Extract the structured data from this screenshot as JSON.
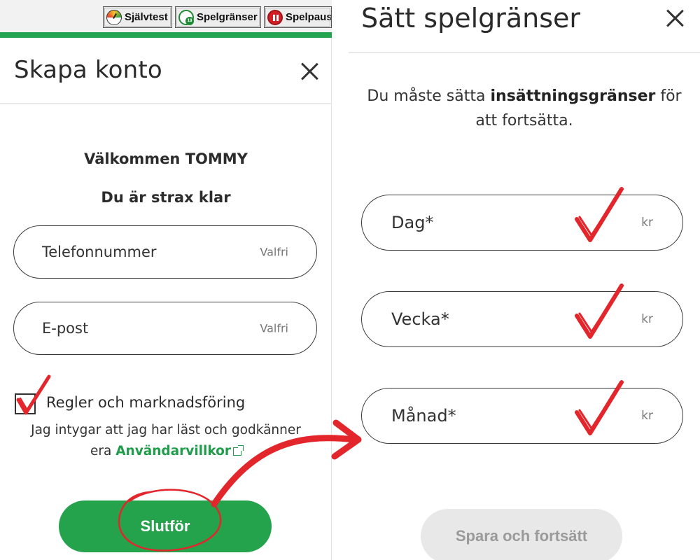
{
  "responsible_gaming": {
    "self_test_label": "Självtest",
    "limits_label": "Spelgränser",
    "pause_label": "Spelpaus"
  },
  "signup": {
    "title": "Skapa konto",
    "welcome": "Välkommen TOMMY",
    "subtitle": "Du är strax klar",
    "phone": {
      "label": "Telefonnummer",
      "hint": "Valfri"
    },
    "email": {
      "label": "E-post",
      "hint": "Valfri"
    },
    "consent_label": "Regler och marknadsföring",
    "consent_text": "Jag intygar att jag har läst och godkänner",
    "consent_prefix": "era",
    "terms_link": "Användarvillkor",
    "finish_button": "Slutför"
  },
  "limits": {
    "title": "Sätt spelgränser",
    "intro_start": "Du måste sätta",
    "intro_bold": "insättningsgränser",
    "intro_end": "för",
    "intro_line2": "att fortsätta.",
    "fields": [
      {
        "label": "Dag",
        "required": "*",
        "unit": "kr"
      },
      {
        "label": "Vecka",
        "required": "*",
        "unit": "kr"
      },
      {
        "label": "Månad",
        "required": "*",
        "unit": "kr"
      }
    ],
    "save_button": "Spara och fortsätt"
  },
  "colors": {
    "brand_green": "#24a24c",
    "annotation_red": "#e3262b",
    "disabled_gray": "#e8e8e8"
  }
}
